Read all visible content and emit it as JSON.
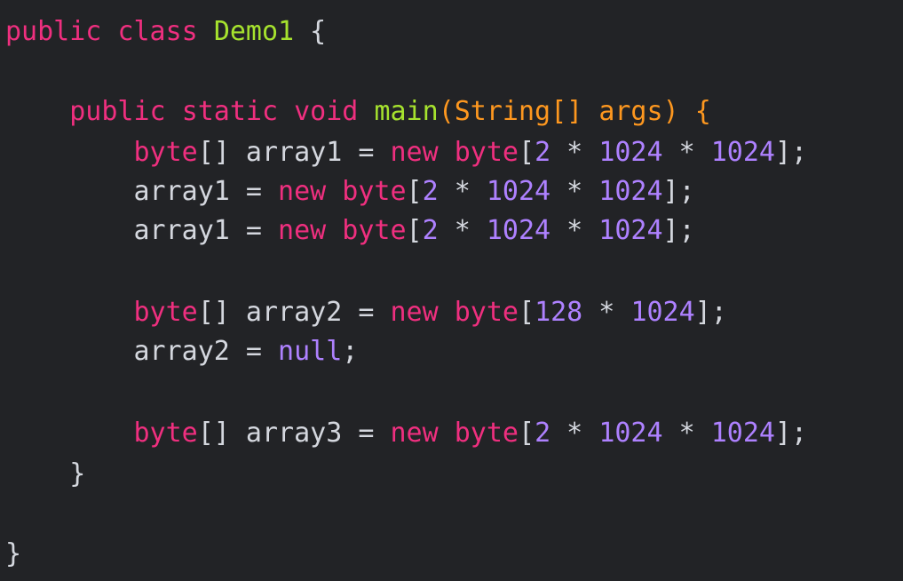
{
  "code": {
    "lines": [
      {
        "text": "public class Demo1 {"
      },
      {
        "text": ""
      },
      {
        "text": "    public static void main(String[] args) {"
      },
      {
        "text": "        byte[] array1 = new byte[2 * 1024 * 1024];"
      },
      {
        "text": "        array1 = new byte[2 * 1024 * 1024];"
      },
      {
        "text": "        array1 = new byte[2 * 1024 * 1024];"
      },
      {
        "text": ""
      },
      {
        "text": "        byte[] array2 = new byte[128 * 1024];"
      },
      {
        "text": "        array2 = null;"
      },
      {
        "text": ""
      },
      {
        "text": "        byte[] array3 = new byte[2 * 1024 * 1024];"
      },
      {
        "text": "    }"
      },
      {
        "text": ""
      },
      {
        "text": "}"
      }
    ],
    "colors": {
      "background": "#222326",
      "default_text": "#d4d7de",
      "keyword": "#ef2f7f",
      "class_name": "#a6e22e",
      "number": "#ae81ff",
      "parameter": "#fd971f"
    }
  }
}
